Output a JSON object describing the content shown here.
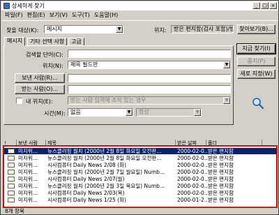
{
  "window": {
    "title": "상세하게 찾기",
    "min": "_",
    "max": "□",
    "close": "×"
  },
  "menu": [
    "파일(F)",
    "편집(E)",
    "보기(V)",
    "도구(T)",
    "도움말(H)"
  ],
  "search_target": {
    "label": "찾을 대상(K):",
    "value": "메시지",
    "location_label": "위치:",
    "location_value": "받은 편지함(검사 포함)/받은 편지..."
  },
  "buttons": {
    "browse": "찾아보기(B)...",
    "find_now": "지금 찾기(I)",
    "stop": "중지(P)",
    "new_search": "새로 지정(W)",
    "from": "보낸 사람(R)...",
    "to": "받는 사람(O)..."
  },
  "tabs": [
    "메시지",
    "기타 선택 사항",
    "고급"
  ],
  "form": {
    "keyword_label": "검색할 단어(C):",
    "keyword_value": "",
    "in_label": "위치(N):",
    "in_value": "제목 필드만",
    "from_value": "",
    "to_value": "",
    "where_label": "내 위치(E):",
    "where_value": "받는 사람 입력에 조작 있는 경우",
    "time_label": "시간(M):",
    "time_value": "없음",
    "time_option_value": "항상"
  },
  "results": {
    "headers": [
      "!",
      "보낸 사람",
      "제목",
      "받은 날짜",
      "폴더"
    ],
    "rows": [
      {
        "from": "미지위...",
        "subject": "뉴스클리핑 월치 (2000년 2월 8일 화요일 오전판...",
        "date": "2000-02-0...",
        "folder": "받은 편지함",
        "selected": true
      },
      {
        "from": "미지위...",
        "subject": "뉴스클리핑 월치 (2000년 2월 8일 화요일 오전판...",
        "date": "2000-02-0...",
        "folder": "받은 편지함",
        "selected": false
      },
      {
        "from": "미지위...",
        "subject": "시사컴퓨터 Daily News 2/08 (화)",
        "date": "2000-02-0...",
        "folder": "받은 편지함",
        "selected": false
      },
      {
        "from": "미지위...",
        "subject": "뉴스클리핑 월치 (2000년 2월 7일 월요일) Numb...",
        "date": "2000-02-0...",
        "folder": "받은 편지함",
        "selected": false
      },
      {
        "from": "미지위...",
        "subject": "시사컴퓨터 Daily News 2/07(월)",
        "date": "2000-02-0...",
        "folder": "받은 편지함",
        "selected": false
      },
      {
        "from": "미지위...",
        "subject": "뉴스클리핑 월치 (2000년 2월 3일 목요일) Numb...",
        "date": "2000-02-0...",
        "folder": "받은 편지함",
        "selected": false
      },
      {
        "from": "미지위...",
        "subject": "시사컴퓨터 Daily News 2/03(목)",
        "date": "2000-02-0...",
        "folder": "받은 편지함",
        "selected": false
      },
      {
        "from": "미지위...",
        "subject": "시사컴퓨터 Daily News 1/25 (화)",
        "date": "2000-01-2...",
        "folder": "받은 편지함",
        "selected": false
      }
    ]
  },
  "status": "8개 항목"
}
